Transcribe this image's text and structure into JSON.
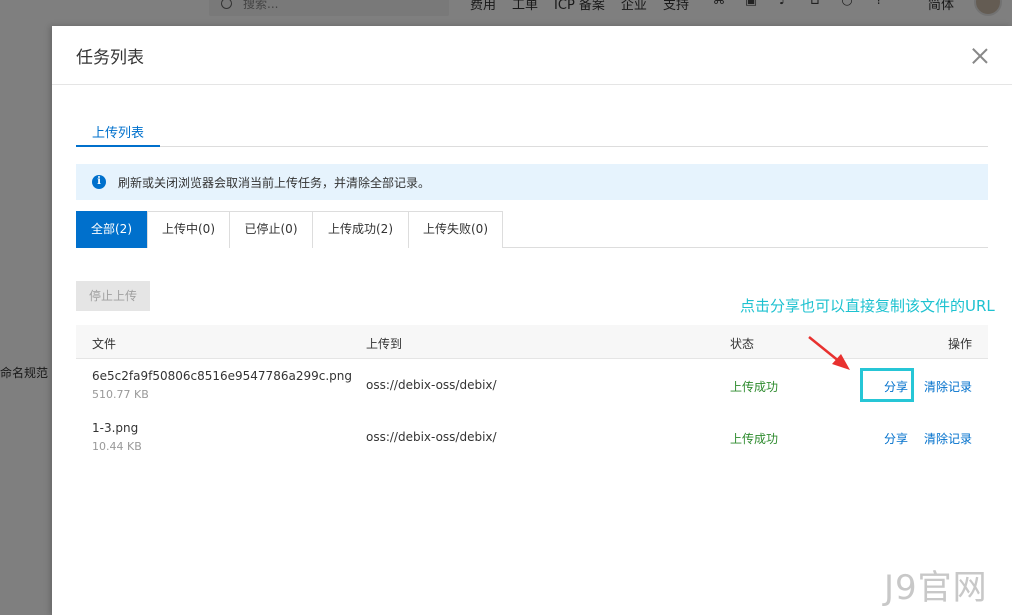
{
  "topbar": {
    "search_placeholder": "搜索...",
    "nav": [
      "费用",
      "工单",
      "ICP 备案",
      "企业",
      "支持"
    ],
    "icons": [
      "app-icon",
      "image-icon",
      "bell-icon",
      "cart-icon",
      "bulb-icon",
      "help-icon"
    ],
    "lang": "简体"
  },
  "left_page": {
    "row_label": "命名规范"
  },
  "drawer": {
    "title": "任务列表",
    "tab_label": "上传列表",
    "notice": "刷新或关闭浏览器会取消当前上传任务，并清除全部记录。",
    "filters": [
      "全部(2)",
      "上传中(0)",
      "已停止(0)",
      "上传成功(2)",
      "上传失败(0)"
    ],
    "stop_button": "停止上传",
    "columns": {
      "file": "文件",
      "dest": "上传到",
      "status": "状态",
      "action": "操作"
    },
    "rows": [
      {
        "name": "6e5c2fa9f50806c8516e9547786a299c.png",
        "size": "510.77 KB",
        "dest": "oss://debix-oss/debix/",
        "status": "上传成功",
        "share": "分享",
        "clear": "清除记录"
      },
      {
        "name": "1-3.png",
        "size": "10.44 KB",
        "dest": "oss://debix-oss/debix/",
        "status": "上传成功",
        "share": "分享",
        "clear": "清除记录"
      }
    ]
  },
  "annotation": {
    "text": "点击分享也可以直接复制该文件的URL",
    "color": "#1ec2d0",
    "arrow_color": "#e8312f"
  },
  "watermark": "J9官网",
  "colors": {
    "primary": "#0070cc",
    "success": "#2e8b2e",
    "highlight": "#26c6d6"
  }
}
